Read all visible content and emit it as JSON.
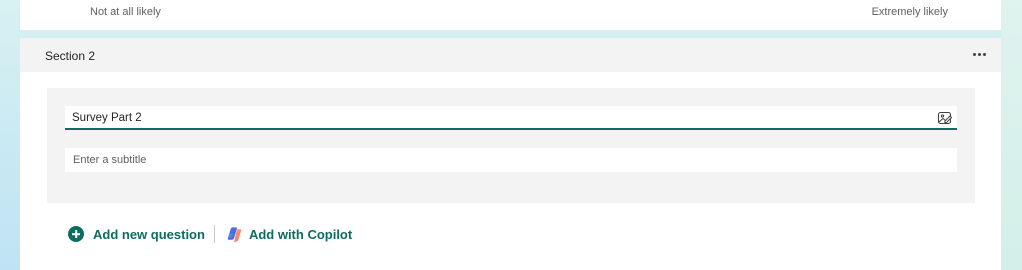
{
  "scale": {
    "low_label": "Not at all likely",
    "high_label": "Extremely likely"
  },
  "section": {
    "title": "Section 2",
    "more_icon": "more-horizontal-icon",
    "form_title_value": "Survey Part 2",
    "subtitle_placeholder": "Enter a subtitle",
    "insert_media_icon": "image-insert-icon"
  },
  "actions": {
    "add_question_label": "Add new question",
    "add_question_icon": "plus-circle-icon",
    "copilot_label": "Add with Copilot",
    "copilot_icon": "copilot-icon"
  },
  "colors": {
    "accent": "#0f6c60",
    "section_bg": "#f3f3f3",
    "page_bg_top": "#d8f1f2",
    "page_bg_bottom": "#bfe3f4"
  }
}
